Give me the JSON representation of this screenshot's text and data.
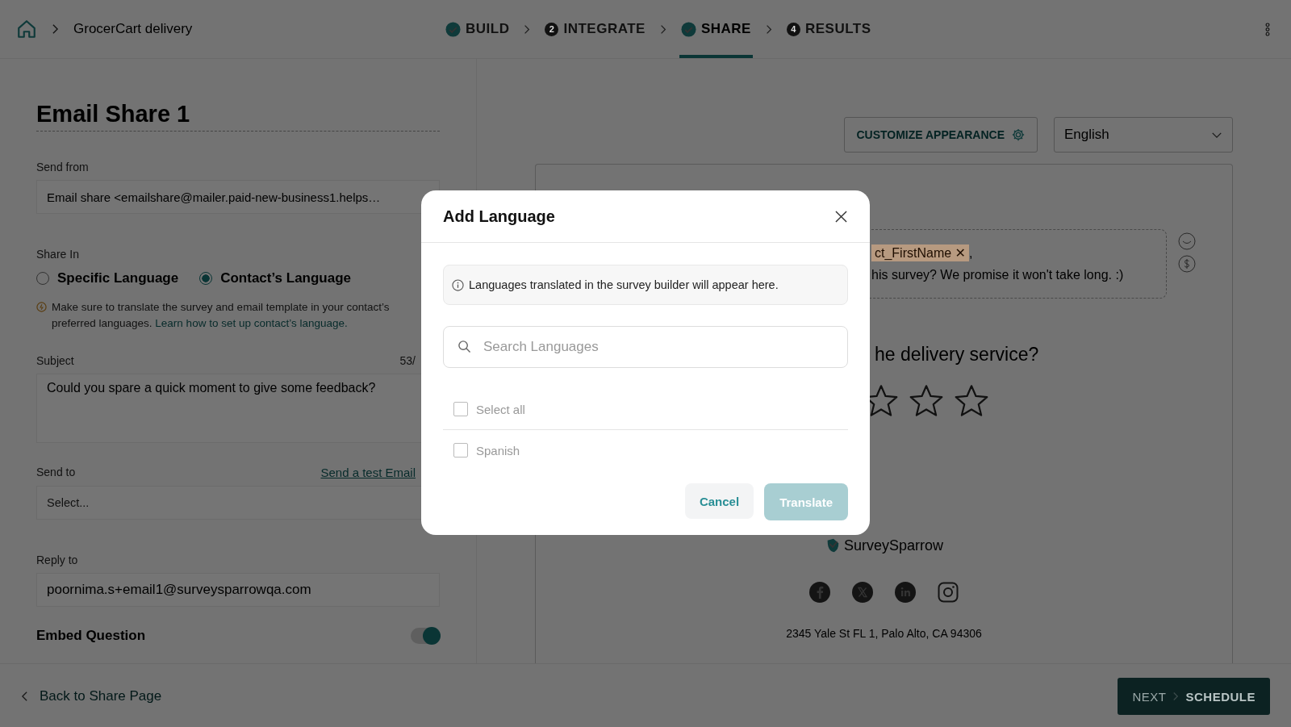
{
  "breadcrumb": {
    "title": "GrocerCart delivery"
  },
  "steps": [
    {
      "kind": "done",
      "label": "BUILD",
      "selected": false
    },
    {
      "kind": "number",
      "number": "2",
      "label": "INTEGRATE",
      "selected": false
    },
    {
      "kind": "done",
      "label": "SHARE",
      "selected": true
    },
    {
      "kind": "number",
      "number": "4",
      "label": "RESULTS",
      "selected": false
    }
  ],
  "form": {
    "title": "Email Share 1",
    "send_from_label": "Send from",
    "send_from_value": "Email share <emailshare@mailer.paid-new-business1.helps…",
    "share_in_label": "Share In",
    "share_options": [
      {
        "label": "Specific Language",
        "selected": false
      },
      {
        "label": "Contact’s Language",
        "selected": true
      }
    ],
    "note": "Make sure to translate the survey and email template in your contact’s preferred languages.",
    "note_link": "Learn how to set up contact’s language.",
    "subject_label": "Subject",
    "subject_count": "53/",
    "subject_value": "Could you spare a quick moment to give some feedback?",
    "send_to_label": "Send to",
    "test_link": "Send a test Email",
    "send_to_placeholder": "Select...",
    "reply_to_label": "Reply to",
    "reply_to_value": "poornima.s+email1@surveysparrowqa.com",
    "embed_label": "Embed Question",
    "embed_on": true
  },
  "preview": {
    "customize_button": "CUSTOMIZE APPEARANCE",
    "language": "English",
    "chip": "ct_FirstName",
    "chip_remove": "✕",
    "after_chip": ",",
    "intro": "his survey? We promise it won't take long. :)",
    "question": "he delivery service?",
    "stars": 0,
    "logo": "SurveySparrow",
    "address": "2345 Yale St FL 1, Palo Alto, CA 94306"
  },
  "footer": {
    "back": "Back to Share Page",
    "next": "NEXT",
    "schedule": "SCHEDULE"
  },
  "dialog": {
    "title": "Add Language",
    "info": "Languages translated in the survey builder will appear here.",
    "search_placeholder": "Search Languages",
    "options": [
      {
        "label": "Select all",
        "checked": false
      },
      {
        "label": "Spanish",
        "checked": false
      }
    ],
    "cancel": "Cancel",
    "confirm": "Translate",
    "confirm_disabled": true
  }
}
